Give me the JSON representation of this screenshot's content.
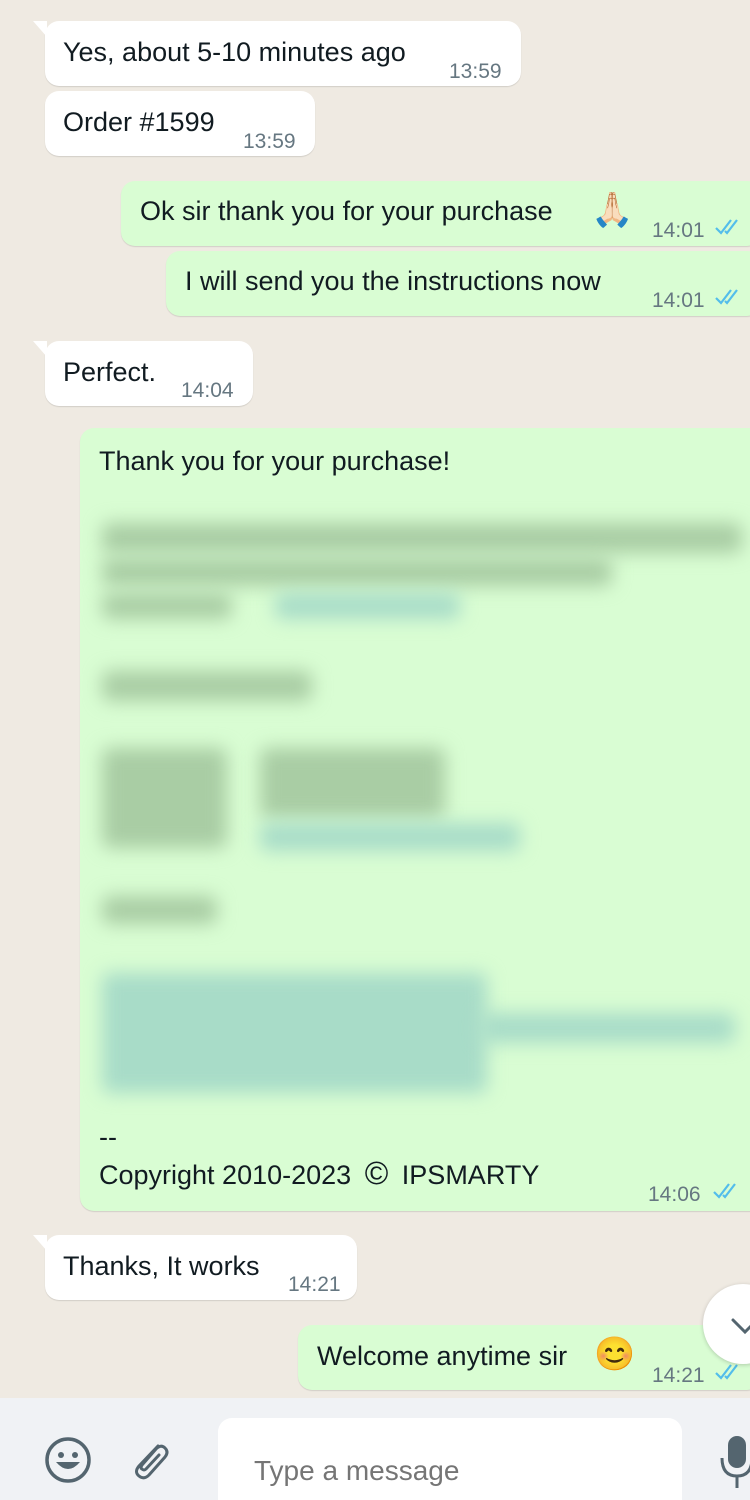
{
  "messages": [
    {
      "direction": "incoming",
      "text": "Yes, about 5-10 minutes ago",
      "time": "13:59"
    },
    {
      "direction": "incoming",
      "text": "Order #1599",
      "time": "13:59"
    },
    {
      "direction": "outgoing",
      "text": "Ok sir thank you for your purchase",
      "emoji": "🙏🏻",
      "time": "14:01",
      "status": "read"
    },
    {
      "direction": "outgoing",
      "text": "I will send you the instructions now",
      "time": "14:01",
      "status": "read"
    },
    {
      "direction": "incoming",
      "text": "Perfect.",
      "time": "14:04"
    },
    {
      "direction": "outgoing",
      "text": "Thank you for your purchase!",
      "separator": "--",
      "footer": "Copyright 2010-2023",
      "copyright_symbol": "©",
      "brand": "IPSMARTY",
      "time": "14:06",
      "status": "read",
      "has_blurred_content": true
    },
    {
      "direction": "incoming",
      "text": "Thanks, It works",
      "time": "14:21"
    },
    {
      "direction": "outgoing",
      "text": "Welcome anytime sir",
      "emoji": "😊",
      "time": "14:21",
      "status": "read"
    }
  ],
  "composer": {
    "placeholder": "Type a message",
    "emoji_icon": "smiley-icon",
    "attach_icon": "paperclip-icon",
    "mic_icon": "microphone-icon"
  },
  "colors": {
    "background": "#efeae2",
    "incoming": "#ffffff",
    "outgoing": "#d9fdd3",
    "read_ticks": "#53bdeb",
    "time": "#667781"
  }
}
